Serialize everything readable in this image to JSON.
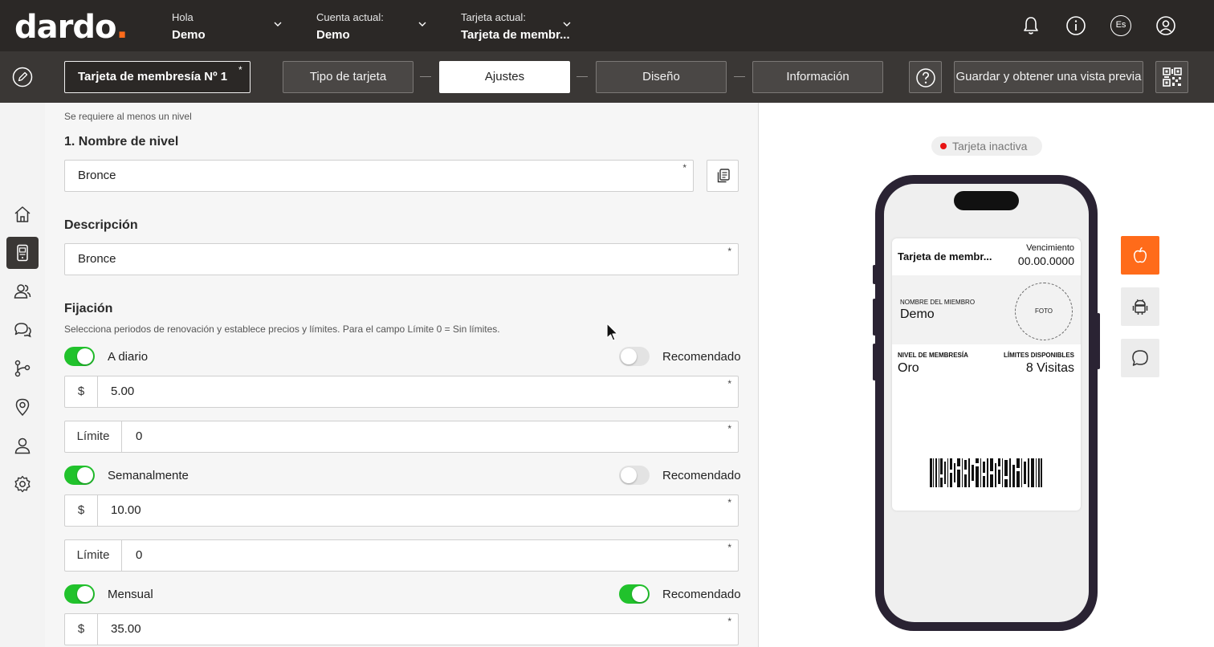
{
  "colors": {
    "header_bg": "#2b2826",
    "subbar_bg": "#3a3735",
    "brand_accent": "#ff6b1a",
    "toggle_on": "#21c22c",
    "status_inactive": "#e81414"
  },
  "header": {
    "logo_text": "dardo",
    "logo_dot": ".",
    "greeting_label": "Hola",
    "greeting_value": "Demo",
    "account_label": "Cuenta actual:",
    "account_value": "Demo",
    "card_label": "Tarjeta actual:",
    "card_value": "Tarjeta de membr...",
    "icons": [
      "bell-icon",
      "info-icon",
      "language-icon",
      "user-account-icon"
    ],
    "language_code": "Es"
  },
  "toolbar": {
    "card_name": "Tarjeta de membresía Nº 1",
    "required_mark": "*",
    "steps": [
      "Tipo de tarjeta",
      "Ajustes",
      "Diseño",
      "Información"
    ],
    "active_step": "Ajustes",
    "save_label": "Guardar y obtener una vista previa"
  },
  "sidebar": {
    "items": [
      "home-icon",
      "card-icon",
      "users-icon",
      "chat-icon",
      "flow-icon",
      "location-icon",
      "user-icon",
      "settings-icon"
    ],
    "active_item": "card-icon"
  },
  "form": {
    "tier_hint": "Se requiere al menos un nivel",
    "tier_name_title": "1. Nombre de nivel",
    "tier_name_value": "Bronce",
    "description_title": "Descripción",
    "description_value": "Bronce",
    "pricing_title": "Fijación",
    "pricing_hint": "Selecciona periodos de renovación y establece precios y límites. Para el campo Límite 0 = Sin límites.",
    "currency_prefix": "$",
    "limit_prefix": "Límite",
    "recommended_label": "Recomendado",
    "periods": [
      {
        "label": "A diario",
        "enabled": true,
        "recommended": false,
        "price": "5.00",
        "limit": "0"
      },
      {
        "label": "Semanalmente",
        "enabled": true,
        "recommended": false,
        "price": "10.00",
        "limit": "0"
      },
      {
        "label": "Mensual",
        "enabled": true,
        "recommended": true,
        "price": "35.00"
      }
    ]
  },
  "preview": {
    "status": "Tarjeta inactiva",
    "pass": {
      "title": "Tarjeta de membr...",
      "expiry_label": "Vencimiento",
      "expiry_value": "00.00.0000",
      "member_label": "NOMBRE DEL MIEMBRO",
      "member_value": "Demo",
      "photo_label": "FOTO",
      "level_label": "NIVEL DE MEMBRESÍA",
      "level_value": "Oro",
      "limits_label": "LÍMITES DISPONIBLES",
      "limits_value": "8 Visitas"
    },
    "platforms": [
      "apple-icon",
      "android-icon",
      "message-icon"
    ],
    "active_platform": "apple-icon"
  }
}
